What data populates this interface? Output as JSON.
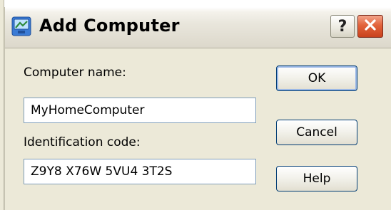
{
  "window": {
    "title": "Add Computer",
    "help_label": "?"
  },
  "form": {
    "computer_name_label": "Computer name:",
    "computer_name_value": "MyHomeComputer",
    "identification_label": "Identification code:",
    "identification_value": "Z9Y8 X76W 5VU4 3T2S"
  },
  "buttons": {
    "ok": "OK",
    "cancel": "Cancel",
    "help": "Help"
  },
  "icons": {
    "app": "add-computer-icon",
    "close": "close-icon"
  },
  "colors": {
    "dialog_bg": "#ece9d8",
    "close_red": "#e2633b",
    "field_border": "#7f9db9",
    "button_border": "#003c74"
  }
}
